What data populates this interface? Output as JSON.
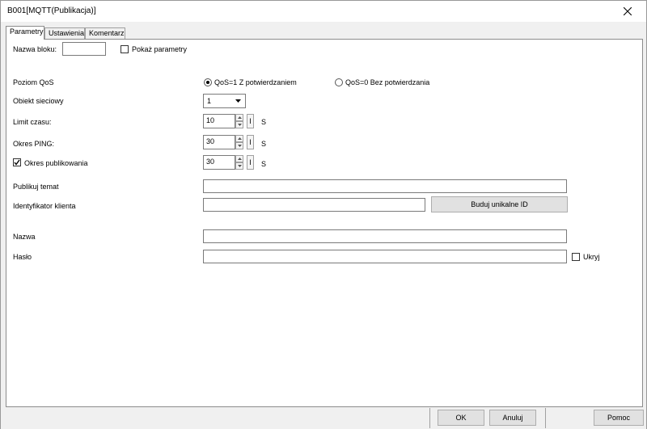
{
  "window": {
    "title": "B001[MQTT(Publikacja)]"
  },
  "tabs": [
    {
      "label": "Parametry",
      "active": true
    },
    {
      "label": "Ustawienia",
      "active": false
    },
    {
      "label": "Komentarz",
      "active": false
    }
  ],
  "block": {
    "name_label": "Nazwa bloku:",
    "name_value": "",
    "show_params_label": "Pokaż parametry",
    "show_params_checked": false
  },
  "qos": {
    "label": "Poziom QoS",
    "option1": "QoS=1 Z potwierdzaniem",
    "option2": "QoS=0 Bez potwierdzania",
    "selected": "option1"
  },
  "network_object": {
    "label": "Obiekt sieciowy",
    "value": "1"
  },
  "timeout": {
    "label": "Limit czasu:",
    "value": "10",
    "unit": "S",
    "extra": "I"
  },
  "ping": {
    "label": "Okres PING:",
    "value": "30",
    "unit": "S",
    "extra": "I"
  },
  "publish_period": {
    "label": "Okres publikowania",
    "checked": true,
    "value": "30",
    "unit": "S",
    "extra": "I"
  },
  "topic": {
    "label": "Publikuj temat",
    "value": ""
  },
  "client_id": {
    "label": "Identyfikator klienta",
    "value": "",
    "build_button": "Buduj unikalne ID"
  },
  "username": {
    "label": "Nazwa",
    "value": ""
  },
  "password": {
    "label": "Hasło",
    "value": "",
    "hide_label": "Ukryj",
    "hide_checked": false
  },
  "footer": {
    "ok": "OK",
    "cancel": "Anuluj",
    "help": "Pomoc"
  },
  "colors": {
    "window_bg": "#f0f0f0",
    "panel_bg": "#ffffff",
    "border": "#7a7a7a"
  }
}
